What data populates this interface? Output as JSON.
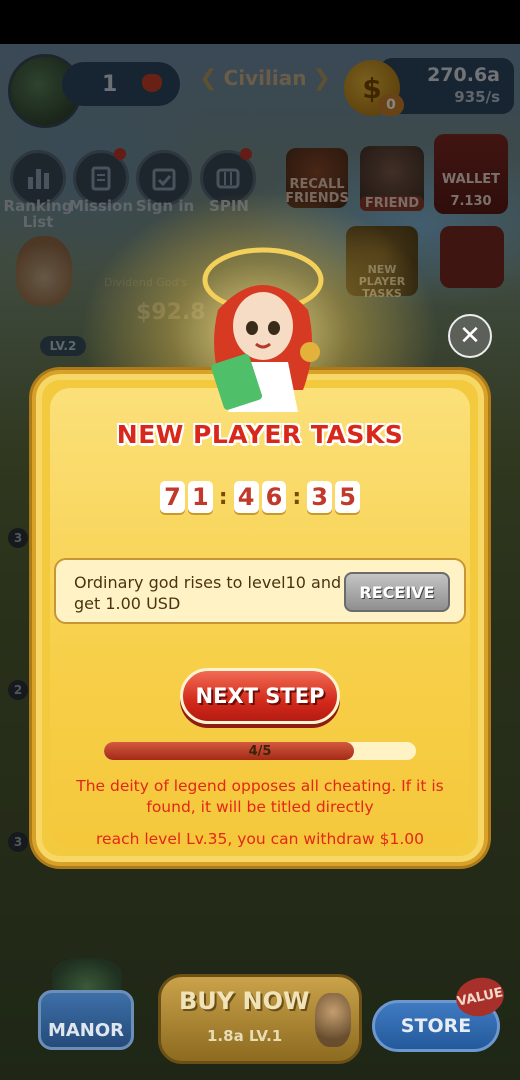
{
  "hud": {
    "level": "1",
    "rank": "Civilian",
    "coin_badge": "0",
    "money": "270.6a",
    "rate": "935/s"
  },
  "menu": {
    "items": [
      {
        "label": "Ranking List"
      },
      {
        "label": "Mission"
      },
      {
        "label": "Sign in"
      },
      {
        "label": "SPIN"
      }
    ]
  },
  "right_menu": {
    "recall_friends": "RECALL FRIENDS",
    "friend": "FRIEND",
    "wallet": "WALLET",
    "wallet_value": "7.130",
    "new_player_tasks": "NEW PLAYER TASKS"
  },
  "god_card": {
    "title": "Dividend God's",
    "value": "$92.8",
    "level": "LV.2"
  },
  "side_numbers": [
    "3",
    "2",
    "3"
  ],
  "modal": {
    "title": "NEW PLAYER TASKS",
    "timer": [
      "7",
      "1",
      "4",
      "6",
      "3",
      "5"
    ],
    "task_text": "Ordinary god rises to level10 and get 1.00 USD",
    "receive_label": "RECEIVE",
    "next_step_label": "NEXT STEP",
    "progress_text": "4/5",
    "progress_value": 0.8,
    "warning": "The deity of legend opposes all cheating. If it is found, it will be titled directly",
    "withdraw": "reach level Lv.35, you can withdraw $1.00",
    "close_icon": "close-icon"
  },
  "bottom": {
    "manor": "MANOR",
    "buy_now": "BUY NOW",
    "buy_sub": "1.8a LV.1",
    "store": "STORE",
    "value": "VALUE"
  },
  "colors": {
    "modal_bg": "#f3c93d",
    "title_red": "#d8281b",
    "button_red": "#d42a1c",
    "receive_gray": "#8f8f8f"
  }
}
